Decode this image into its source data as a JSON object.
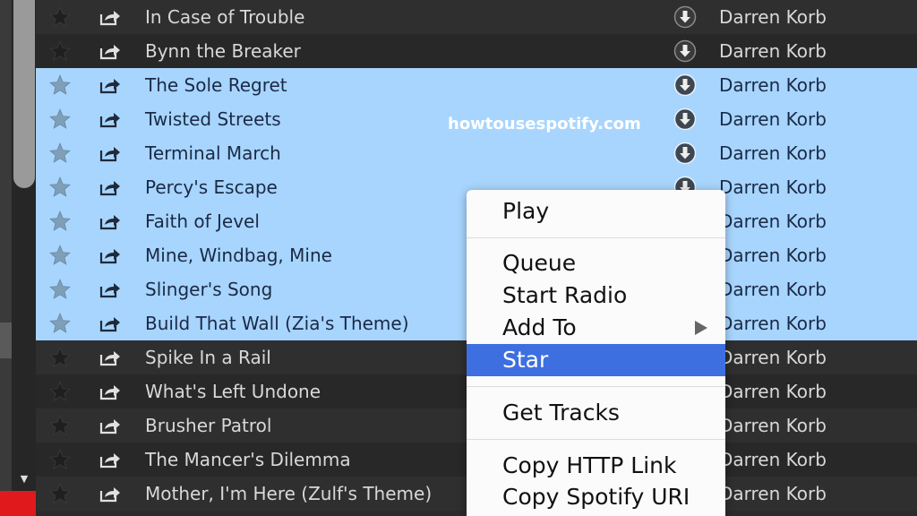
{
  "watermark": "howtousespotify.com",
  "tracks": [
    {
      "title": "In Case of Trouble",
      "artist": "Darren Korb",
      "selected": false
    },
    {
      "title": "Bynn the Breaker",
      "artist": "Darren Korb",
      "selected": false
    },
    {
      "title": "The Sole Regret",
      "artist": "Darren Korb",
      "selected": true
    },
    {
      "title": "Twisted Streets",
      "artist": "Darren Korb",
      "selected": true
    },
    {
      "title": "Terminal March",
      "artist": "Darren Korb",
      "selected": true
    },
    {
      "title": "Percy's Escape",
      "artist": "Darren Korb",
      "selected": true
    },
    {
      "title": "Faith of Jevel",
      "artist": "Darren Korb",
      "selected": true
    },
    {
      "title": "Mine, Windbag, Mine",
      "artist": "Darren Korb",
      "selected": true
    },
    {
      "title": "Slinger's Song",
      "artist": "Darren Korb",
      "selected": true
    },
    {
      "title": "Build That Wall (Zia's Theme)",
      "artist": "Darren Korb",
      "selected": true
    },
    {
      "title": "Spike In a Rail",
      "artist": "Darren Korb",
      "selected": false
    },
    {
      "title": "What's Left Undone",
      "artist": "Darren Korb",
      "selected": false
    },
    {
      "title": "Brusher Patrol",
      "artist": "Darren Korb",
      "selected": false
    },
    {
      "title": "The Mancer's Dilemma",
      "artist": "Darren Korb",
      "selected": false
    },
    {
      "title": "Mother, I'm Here (Zulf's Theme)",
      "artist": "Darren Korb",
      "selected": false
    }
  ],
  "context_menu": {
    "items": [
      {
        "label": "Play",
        "highlighted": false
      },
      {
        "label": "Queue",
        "highlighted": false
      },
      {
        "label": "Start Radio",
        "highlighted": false
      },
      {
        "label": "Add To",
        "highlighted": false,
        "submenu": true
      },
      {
        "label": "Star",
        "highlighted": true
      },
      {
        "label": "Get Tracks",
        "highlighted": false
      },
      {
        "label": "Copy HTTP Link",
        "highlighted": false
      },
      {
        "label": "Copy Spotify URI",
        "highlighted": false
      }
    ]
  },
  "colors": {
    "selection": "#a8d5fd",
    "menu_highlight": "#3d6fe0",
    "row_dark": "#2f2f2f"
  }
}
